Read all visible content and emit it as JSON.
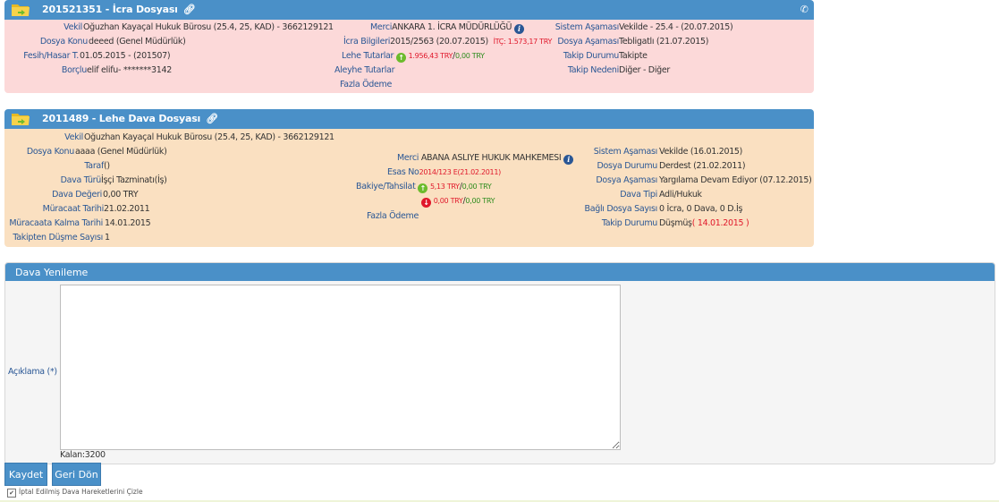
{
  "icra_panel": {
    "title": "201521351 - İcra Dosyası",
    "col1": [
      {
        "label": "Vekil",
        "value": "Oğuzhan Kayaçal Hukuk Bürosu  (25.4, 25, KAD) - 3662129121"
      },
      {
        "label": "Dosya Konu",
        "value": "deeed (Genel Müdürlük)"
      },
      {
        "label": "Fesih/Hasar T.",
        "value": "01.05.2015 - (201507)"
      },
      {
        "label": "Borçlu",
        "value": "elif elifu- *******3142"
      }
    ],
    "merci_label": "Merci",
    "merci_value": "ANKARA 1. İCRA MÜDÜRLÜĞÜ",
    "icra_bilgileri_label": "İcra Bilgileri",
    "icra_bilgileri_value": "2015/2563 (20.07.2015)",
    "itc_value": "İTÇ: 1.573,17 TRY",
    "lehe_tutarlar_label": "Lehe Tutarlar",
    "lehe_red": "1.956,43 TRY",
    "lehe_sep": "/",
    "lehe_green": "0,00 TRY",
    "aleyhe_tutarlar_label": "Aleyhe Tutarlar",
    "fazla_odeme_label": "Fazla Ödeme",
    "col3": [
      {
        "label": "Sistem Aşaması",
        "value": "Vekilde - 25.4 - (20.07.2015)"
      },
      {
        "label": "Dosya Aşaması",
        "value": "Tebligatlı (21.07.2015)"
      },
      {
        "label": "Takip Durumu",
        "value": "Takipte"
      },
      {
        "label": "Takip Nedeni",
        "value": "Diğer - Diğer"
      }
    ]
  },
  "dava_panel": {
    "title": "2011489 - Lehe Dava Dosyası",
    "vekil_label": "Vekil",
    "vekil_value": "Oğuzhan Kayaçal Hukuk Bürosu  (25.4, 25, KAD) - 3662129121",
    "col1": [
      {
        "label": "Dosya Konu",
        "value": "aaaa (Genel Müdürlük)"
      },
      {
        "label": "Taraf",
        "value": " ()"
      },
      {
        "label": "Dava Türü",
        "value": "İşçi Tazminatı(İş)"
      },
      {
        "label": "Dava Değeri",
        "value": "0,00 TRY"
      },
      {
        "label": "Müracaat Tarihi",
        "value": "21.02.2011"
      },
      {
        "label": "Müracaata Kalma Tarihi",
        "value": "14.01.2015"
      },
      {
        "label": "Takipten Düşme Sayısı",
        "value": "1"
      }
    ],
    "merci_label": "Merci",
    "merci_value": "ABANA ASLIYE HUKUK MAHKEMESI",
    "esas_no_label": "Esas No",
    "esas_no_value": "2014/123 E(21.02.2011)",
    "bakiye_label": "Bakiye/Tahsilat",
    "bakiye_up_red": "5,13 TRY",
    "bakiye_up_green": "0,00 TRY",
    "bakiye_down_red": "0,00 TRY",
    "bakiye_down_green": "0,00 TRY",
    "sep": "/",
    "fazla_odeme_label": "Fazla Ödeme",
    "col3": [
      {
        "label": "Sistem Aşaması",
        "value": "Vekilde (16.01.2015)"
      },
      {
        "label": "Dosya Durumu",
        "value": "Derdest (21.02.2011)"
      },
      {
        "label": "Dosya Aşaması",
        "value": "Yargılama Devam Ediyor (07.12.2015)"
      },
      {
        "label": "Dava Tipi",
        "value": "Adli/Hukuk"
      },
      {
        "label": "Bağlı Dosya Sayısı",
        "value": "0 İcra, 0 Dava, 0 D.İş"
      }
    ],
    "takip_durumu_label": "Takip Durumu",
    "takip_durumu_value": "Düşmüş",
    "takip_durumu_date": "( 14.01.2015 )"
  },
  "form": {
    "title": "Dava Yenileme",
    "aciklama_label": "Açıklama (*)",
    "aciklama_value": "",
    "kalan_label": "Kalan:3200"
  },
  "buttons": {
    "save": "Kaydet",
    "back": "Geri Dön"
  },
  "checkbox": {
    "label": "İptal Edilmiş Dava Hareketlerini Çizle",
    "checked": true
  },
  "colors": {
    "header_blue": "#4a90c8",
    "pink_bg": "#fcd9d9",
    "orange_bg": "#fae0c1",
    "label_blue": "#2a5795",
    "red": "#e0182b",
    "green": "#2e8c1e"
  },
  "icons": [
    "folder-icon",
    "link-icon",
    "phone-icon",
    "info-icon",
    "arrow-up-icon",
    "arrow-down-icon"
  ]
}
